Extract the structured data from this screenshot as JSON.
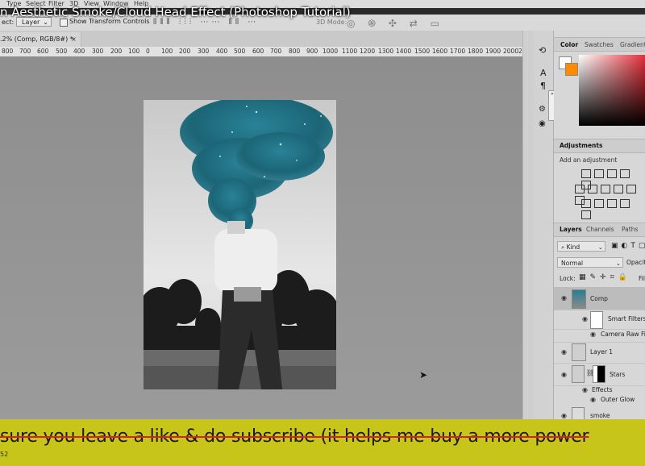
{
  "menubar": {
    "items": [
      "Type",
      "Select",
      "Filter",
      "3D",
      "View",
      "Window",
      "Help"
    ]
  },
  "video_title": "n Aesthetic Smoke/Cloud Head Effect (Photoshop Tutorial)",
  "options_bar": {
    "select_label": "ect:",
    "select_value": "Layer",
    "transform_controls": "Show Transform Controls",
    "mode_3d": "3D Mode:"
  },
  "document": {
    "tab_title": ".2% (Comp, RGB/8#) *",
    "close_glyph": "×"
  },
  "ruler": {
    "ticks": [
      "800",
      "700",
      "600",
      "500",
      "400",
      "300",
      "200",
      "100",
      "0",
      "100",
      "200",
      "300",
      "400",
      "500",
      "600",
      "700",
      "800",
      "900",
      "1000",
      "1100",
      "1200",
      "1300",
      "1400",
      "1500",
      "1600",
      "1700",
      "1800",
      "1900",
      "2000",
      "2"
    ]
  },
  "color_panel": {
    "tabs": [
      "Color",
      "Swatches",
      "Gradients"
    ],
    "foreground": "#ffffff",
    "background": "#ff8a00"
  },
  "adjustments_panel": {
    "title": "Adjustments",
    "subtitle": "Add an adjustment"
  },
  "layers_panel": {
    "tabs": [
      "Layers",
      "Channels",
      "Paths"
    ],
    "filter_kind": "Kind",
    "blend_mode": "Normal",
    "opacity_label": "Opacity",
    "lock_label": "Lock:",
    "fill_label": "Fil",
    "layers": [
      {
        "name": "Comp"
      },
      {
        "name": "Smart Filters"
      },
      {
        "name": "Camera Raw Filte"
      },
      {
        "name": "Layer 1"
      },
      {
        "name": "Stars"
      },
      {
        "name": "Effects"
      },
      {
        "name": "Outer Glow"
      },
      {
        "name": "smoke"
      }
    ]
  },
  "subtitle": "sure you leave a like & do subscribe (it helps me buy a more power",
  "timecode": "52",
  "colors": {
    "subtitle_band": "#c7c41a",
    "strike": "#d6202a",
    "cloud_teal": "#1f6f82"
  }
}
